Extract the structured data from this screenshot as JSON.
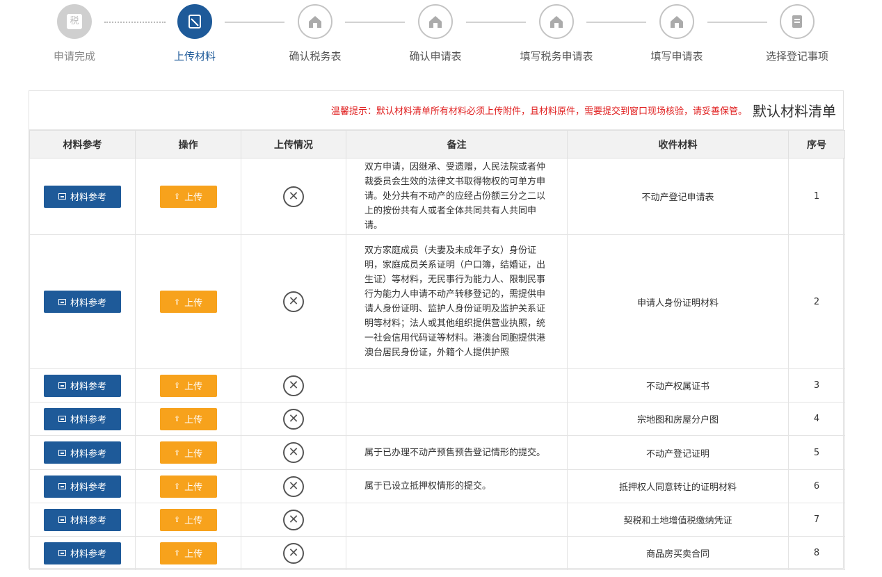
{
  "steps": [
    {
      "label": "申请完成",
      "icon": "tax-stamp-icon",
      "state": "done"
    },
    {
      "label": "上传材料",
      "icon": "document-check-icon",
      "state": "active"
    },
    {
      "label": "确认税务表",
      "icon": "house-icon",
      "state": "todo"
    },
    {
      "label": "确认申请表",
      "icon": "house-icon",
      "state": "todo"
    },
    {
      "label": "填写税务申请表",
      "icon": "house-icon",
      "state": "todo"
    },
    {
      "label": "填写申请表",
      "icon": "house-icon",
      "state": "todo"
    },
    {
      "label": "选择登记事项",
      "icon": "list-icon",
      "state": "todo"
    }
  ],
  "step_done_icon_text": "税",
  "panel": {
    "title": "默认材料清单",
    "tip": "温馨提示：默认材料清单所有材料必须上传附件，且材料原件，需要提交到窗口现场核验，请妥善保管。"
  },
  "table": {
    "headers": {
      "ref": "材料参考",
      "action": "操作",
      "status": "上传情况",
      "note": "备注",
      "material": "收件材料",
      "no": "序号"
    },
    "ref_label": "材料参考",
    "upload_label": "上传",
    "status_symbol": "✕",
    "rows": [
      {
        "no": "1",
        "material": "不动产登记申请表",
        "note": "双方申请，因继承、受遗赠，人民法院或者仲裁委员会生效的法律文书取得物权的可单方申请。处分共有不动产的应经占份额三分之二以上的按份共有人或者全体共同共有人共同申请。"
      },
      {
        "no": "2",
        "material": "申请人身份证明材料",
        "note": "双方家庭成员（夫妻及未成年子女）身份证明，家庭成员关系证明（户口簿，结婚证，出生证）等材料，无民事行为能力人、限制民事行为能力人申请不动产转移登记的，需提供申请人身份证明、监护人身份证明及监护关系证明等材料；法人或其他组织提供营业执照，统一社会信用代码证等材料。港澳台同胞提供港澳台居民身份证，外籍个人提供护照"
      },
      {
        "no": "3",
        "material": "不动产权属证书",
        "note": ""
      },
      {
        "no": "4",
        "material": "宗地图和房屋分户图",
        "note": ""
      },
      {
        "no": "5",
        "material": "不动产登记证明",
        "note": "属于已办理不动产预售预告登记情形的提交。"
      },
      {
        "no": "6",
        "material": "抵押权人同意转让的证明材料",
        "note": "属于已设立抵押权情形的提交。"
      },
      {
        "no": "7",
        "material": "契税和土地增值税缴纳凭证",
        "note": ""
      },
      {
        "no": "8",
        "material": "商品房买卖合同",
        "note": ""
      }
    ]
  },
  "colors": {
    "primary": "#1e5a99",
    "upload": "#f7a21c",
    "tip": "#e02020"
  }
}
